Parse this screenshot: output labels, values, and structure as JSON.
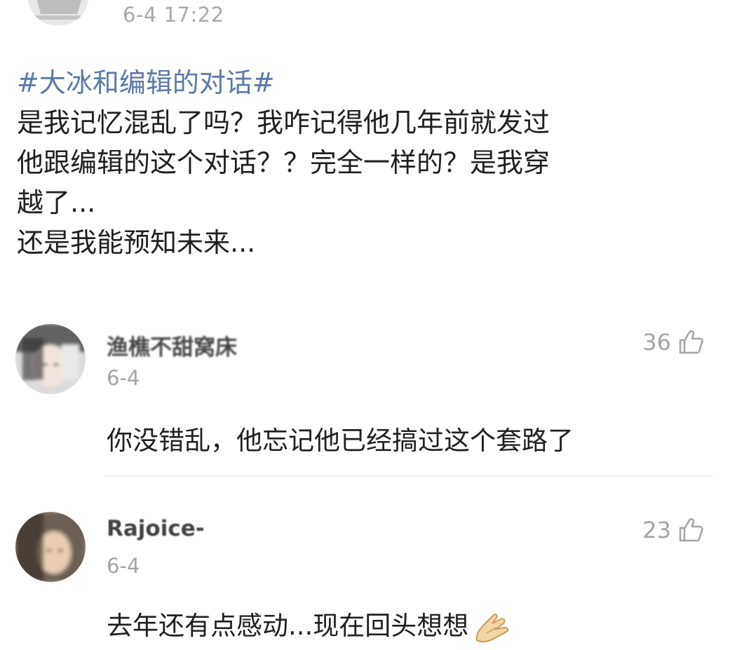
{
  "post": {
    "timestamp": "6-4 17:22",
    "topic": "#大冰和编辑的对话#",
    "lines": [
      "是我记忆混乱了吗？我咋记得他几年前就发过",
      "他跟编辑的这个对话？？完全一样的？是我穿",
      "越了...",
      "还是我能预知未来..."
    ]
  },
  "comments": [
    {
      "username": "渔樵不甜窝床",
      "date": "6-4",
      "likes": "36",
      "text": "你没错乱，他忘记他已经搞过这个套路了"
    },
    {
      "username": "Rajoice-",
      "date": "6-4",
      "likes": "23",
      "text": "去年还有点感动...现在回头想想"
    }
  ],
  "icons": {
    "like": "thumbs-up-icon",
    "emoji": "folded-hands-icon"
  },
  "colors": {
    "topic_link": "#5b78a8",
    "meta_gray": "#a4a4a4",
    "body_text": "#1f1f1f"
  }
}
